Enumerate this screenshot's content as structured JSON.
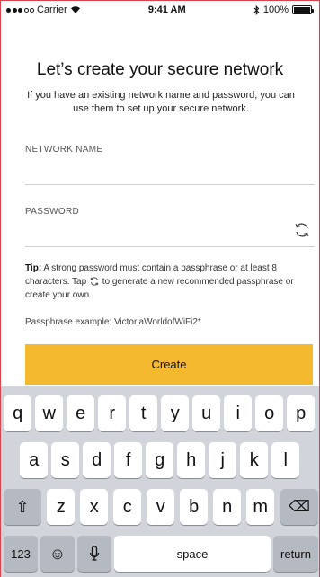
{
  "status_bar": {
    "carrier": "Carrier",
    "time": "9:41 AM",
    "battery": "100%",
    "battery_level": 1.0,
    "signal_bars": 3
  },
  "header": {
    "title": "Let’s create your secure network",
    "subtitle": "If you have an existing network name and password, you can use them to set up your secure network."
  },
  "form": {
    "network_name": {
      "label": "NETWORK NAME",
      "value": "",
      "placeholder": ""
    },
    "password": {
      "label": "PASSWORD",
      "value": "",
      "placeholder": ""
    }
  },
  "tip": {
    "heading": "Tip:",
    "part1": " A strong password must contain a passphrase or at least 8 characters. Tap ",
    "part2": " to generate a new recommended passphrase or create your own."
  },
  "example": "Passphrase example: VictoriaWorldofWiFi2*",
  "buttons": {
    "create": "Create"
  },
  "keyboard": {
    "row1": [
      "q",
      "w",
      "e",
      "r",
      "t",
      "y",
      "u",
      "i",
      "o",
      "p"
    ],
    "row2": [
      "a",
      "s",
      "d",
      "f",
      "g",
      "h",
      "j",
      "k",
      "l"
    ],
    "row3": [
      "z",
      "x",
      "c",
      "v",
      "b",
      "n",
      "m"
    ],
    "shift": "⇧",
    "delete": "⌫",
    "numbers": "123",
    "emoji": "☺",
    "mic": "🎙",
    "space": "space",
    "return": "return"
  },
  "colors": {
    "accent": "#f5b930",
    "keyboard_bg": "#d1d4da",
    "frame_border": "#d9434e"
  },
  "icons": {
    "refresh": "refresh-icon",
    "wifi": "wifi-icon",
    "bluetooth": "bluetooth-icon"
  }
}
